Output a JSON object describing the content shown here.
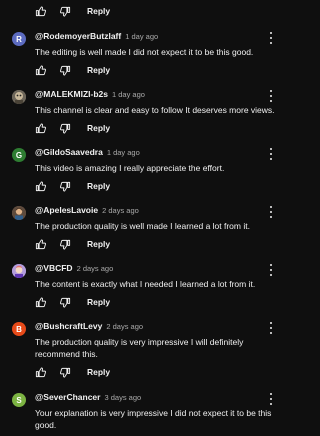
{
  "top_actions": {
    "reply_label": "Reply"
  },
  "comments": [
    {
      "avatar_letter": "R",
      "avatar_color": "#5c6bc0",
      "author": "@RodemoyerButzlaff",
      "time": "1 day ago",
      "text": "The editing is well made I did not expect it to be this good.",
      "reply_label": "Reply"
    },
    {
      "avatar_letter": "",
      "avatar_color": "#7d7568",
      "author": "@MALEKMIZI-b2s",
      "time": "1 day ago",
      "text": "This channel is clear and easy to follow It deserves more views.",
      "reply_label": "Reply"
    },
    {
      "avatar_letter": "G",
      "avatar_color": "#2e7d32",
      "author": "@GildoSaavedra",
      "time": "1 day ago",
      "text": "This video is amazing I really appreciate the effort.",
      "reply_label": "Reply"
    },
    {
      "avatar_letter": "",
      "avatar_color": "#8d6e63",
      "author": "@ApelesLavoie",
      "time": "2 days ago",
      "text": "The production quality is well made I learned a lot from it.",
      "reply_label": "Reply"
    },
    {
      "avatar_letter": "",
      "avatar_color": "#9575cd",
      "author": "@VBCFD",
      "time": "2 days ago",
      "text": "The content is exactly what I needed I learned a lot from it.",
      "reply_label": "Reply"
    },
    {
      "avatar_letter": "B",
      "avatar_color": "#e64a19",
      "author": "@BushcraftLevy",
      "time": "2 days ago",
      "text": "The production quality is very impressive I will definitely recommend this.",
      "reply_label": "Reply"
    },
    {
      "avatar_letter": "S",
      "avatar_color": "#7cb342",
      "author": "@SeverChancer",
      "time": "3 days ago",
      "text": "Your explanation is very impressive I did not expect it to be this good.",
      "reply_label": "Reply"
    }
  ]
}
